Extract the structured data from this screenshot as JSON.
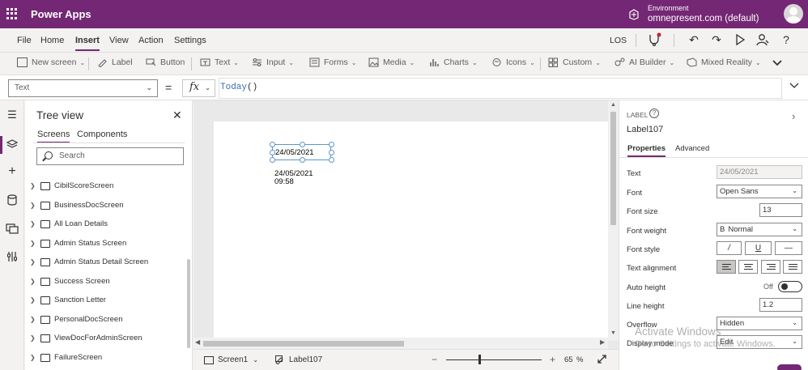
{
  "app": {
    "title": "Power Apps"
  },
  "environment": {
    "label": "Environment",
    "name": "omnepresent.com (default)"
  },
  "menu": {
    "items": [
      "File",
      "Home",
      "Insert",
      "View",
      "Action",
      "Settings"
    ],
    "active": "Insert",
    "user_initials": "LOS"
  },
  "ribbon": [
    {
      "label": "New screen",
      "icon": "new-screen-icon"
    },
    {
      "label": "Label",
      "icon": "label-icon"
    },
    {
      "label": "Button",
      "icon": "button-icon"
    },
    {
      "label": "Text",
      "icon": "text-icon"
    },
    {
      "label": "Input",
      "icon": "input-icon"
    },
    {
      "label": "Forms",
      "icon": "forms-icon"
    },
    {
      "label": "Media",
      "icon": "media-icon"
    },
    {
      "label": "Charts",
      "icon": "charts-icon"
    },
    {
      "label": "Icons",
      "icon": "icons-icon"
    },
    {
      "label": "Custom",
      "icon": "custom-icon"
    },
    {
      "label": "AI Builder",
      "icon": "ai-builder-icon"
    },
    {
      "label": "Mixed Reality",
      "icon": "mixed-reality-icon"
    }
  ],
  "formula_bar": {
    "property": "Text",
    "fx": "fx",
    "formula_fn": "Today",
    "formula_args": "()"
  },
  "tree": {
    "title": "Tree view",
    "tabs": [
      "Screens",
      "Components"
    ],
    "active_tab": "Screens",
    "search_placeholder": "Search",
    "items": [
      "CibilScoreScreen",
      "BusinessDocScreen",
      "All Loan Details",
      "Admin Status Screen",
      "Admin Status Detail Screen",
      "Success Screen",
      "Sanction Letter",
      "PersonalDocScreen",
      "ViewDocForAdminScreen",
      "FailureScreen"
    ]
  },
  "canvas": {
    "selected_label_text": "24/05/2021",
    "label2_line1": "24/05/2021",
    "label2_line2": "09:58"
  },
  "status_bar": {
    "screen": "Screen1",
    "control": "Label107",
    "zoom": "65",
    "zoom_unit": "%",
    "zoom_fraction": 0.35
  },
  "properties": {
    "type": "LABEL",
    "name": "Label107",
    "tabs": [
      "Properties",
      "Advanced"
    ],
    "text_label": "Text",
    "text_value": "24/05/2021",
    "font_label": "Font",
    "font_value": "Open Sans",
    "font_size_label": "Font size",
    "font_size_value": "13",
    "font_weight_label": "Font weight",
    "font_weight_value": "Normal",
    "font_weight_glyph": "B",
    "font_style_label": "Font style",
    "text_alignment_label": "Text alignment",
    "auto_height_label": "Auto height",
    "auto_height_value": "Off",
    "line_height_label": "Line height",
    "line_height_value": "1.2",
    "overflow_label": "Overflow",
    "overflow_value": "Hidden",
    "display_mode_label": "Display mode",
    "display_mode_value": "Edit"
  },
  "watermark": {
    "line1": "Activate Windows",
    "line2": "Go to Settings to activate Windows."
  },
  "colors": {
    "brand": "#742774",
    "selection": "#5d97d0",
    "formula_fn": "#3b6cb5"
  }
}
